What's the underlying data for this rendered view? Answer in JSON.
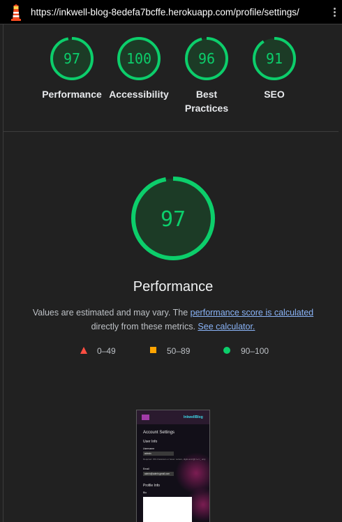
{
  "browser": {
    "url": "https://inkwell-blog-8edefa7bcffe.herokuapp.com/profile/settings/"
  },
  "colors": {
    "pass": "#0cce6b",
    "average": "#ffa400",
    "fail": "#ff4e42",
    "link": "#8ab4f8"
  },
  "categories": [
    {
      "score": 97,
      "label": "Performance"
    },
    {
      "score": 100,
      "label": "Accessibility"
    },
    {
      "score": 96,
      "label": "Best Practices"
    },
    {
      "score": 91,
      "label": "SEO"
    }
  ],
  "performance": {
    "score": 97,
    "title": "Performance",
    "desc_prefix": "Values are estimated and may vary. The ",
    "desc_link1": "performance score is calculated",
    "desc_middle": " directly from these metrics. ",
    "desc_link2": "See calculator."
  },
  "legend": {
    "fail": "0–49",
    "average": "50–89",
    "pass": "90–100"
  },
  "thumbnail": {
    "brand": "InkwellBlog",
    "heading": "Account Settings",
    "section1": "User Info",
    "username_label": "Username",
    "username_value": "admin",
    "helper": "Required. 150 characters or fewer. Letters, digits and @/./+/-/_ only.",
    "email_label": "Email",
    "email_value": "admin@admin.gmail.com",
    "section2": "Profile Info",
    "bio_label": "Bio"
  }
}
